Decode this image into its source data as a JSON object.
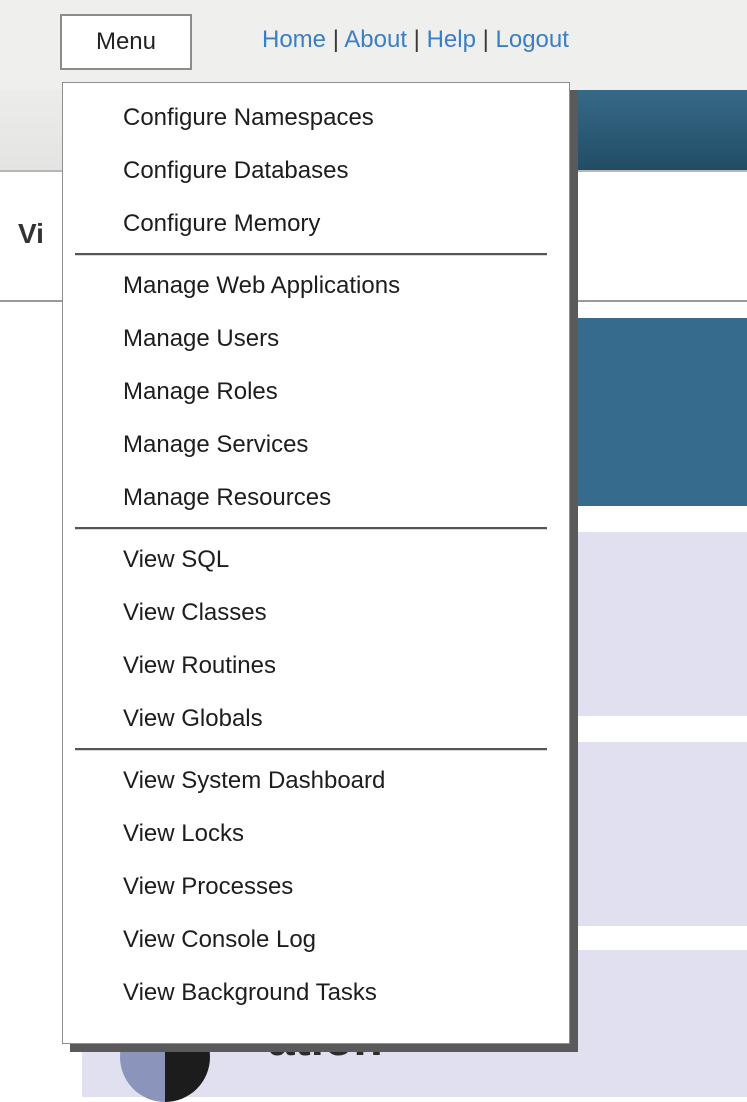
{
  "header": {
    "menu_label": "Menu",
    "links": [
      {
        "label": "Home"
      },
      {
        "label": "About"
      },
      {
        "label": "Help"
      },
      {
        "label": "Logout"
      }
    ],
    "separator": "|"
  },
  "page": {
    "view_label_fragment": "Vi",
    "section_title_fragment": "ation"
  },
  "menu": {
    "groups": [
      {
        "items": [
          {
            "label": "Configure Namespaces"
          },
          {
            "label": "Configure Databases"
          },
          {
            "label": "Configure Memory"
          }
        ]
      },
      {
        "items": [
          {
            "label": "Manage Web Applications"
          },
          {
            "label": "Manage Users"
          },
          {
            "label": "Manage Roles"
          },
          {
            "label": "Manage Services"
          },
          {
            "label": "Manage Resources"
          }
        ]
      },
      {
        "items": [
          {
            "label": "View SQL"
          },
          {
            "label": "View Classes"
          },
          {
            "label": "View Routines"
          },
          {
            "label": "View Globals"
          }
        ]
      },
      {
        "items": [
          {
            "label": "View System Dashboard"
          },
          {
            "label": "View Locks"
          },
          {
            "label": "View Processes"
          },
          {
            "label": "View Console Log"
          },
          {
            "label": "View Background Tasks"
          }
        ]
      }
    ]
  },
  "colors": {
    "link": "#3a7fc6",
    "header_blue": "#376b8d",
    "panel_lilac": "#e1e0f0",
    "menu_shadow": "#5a5a5a"
  }
}
